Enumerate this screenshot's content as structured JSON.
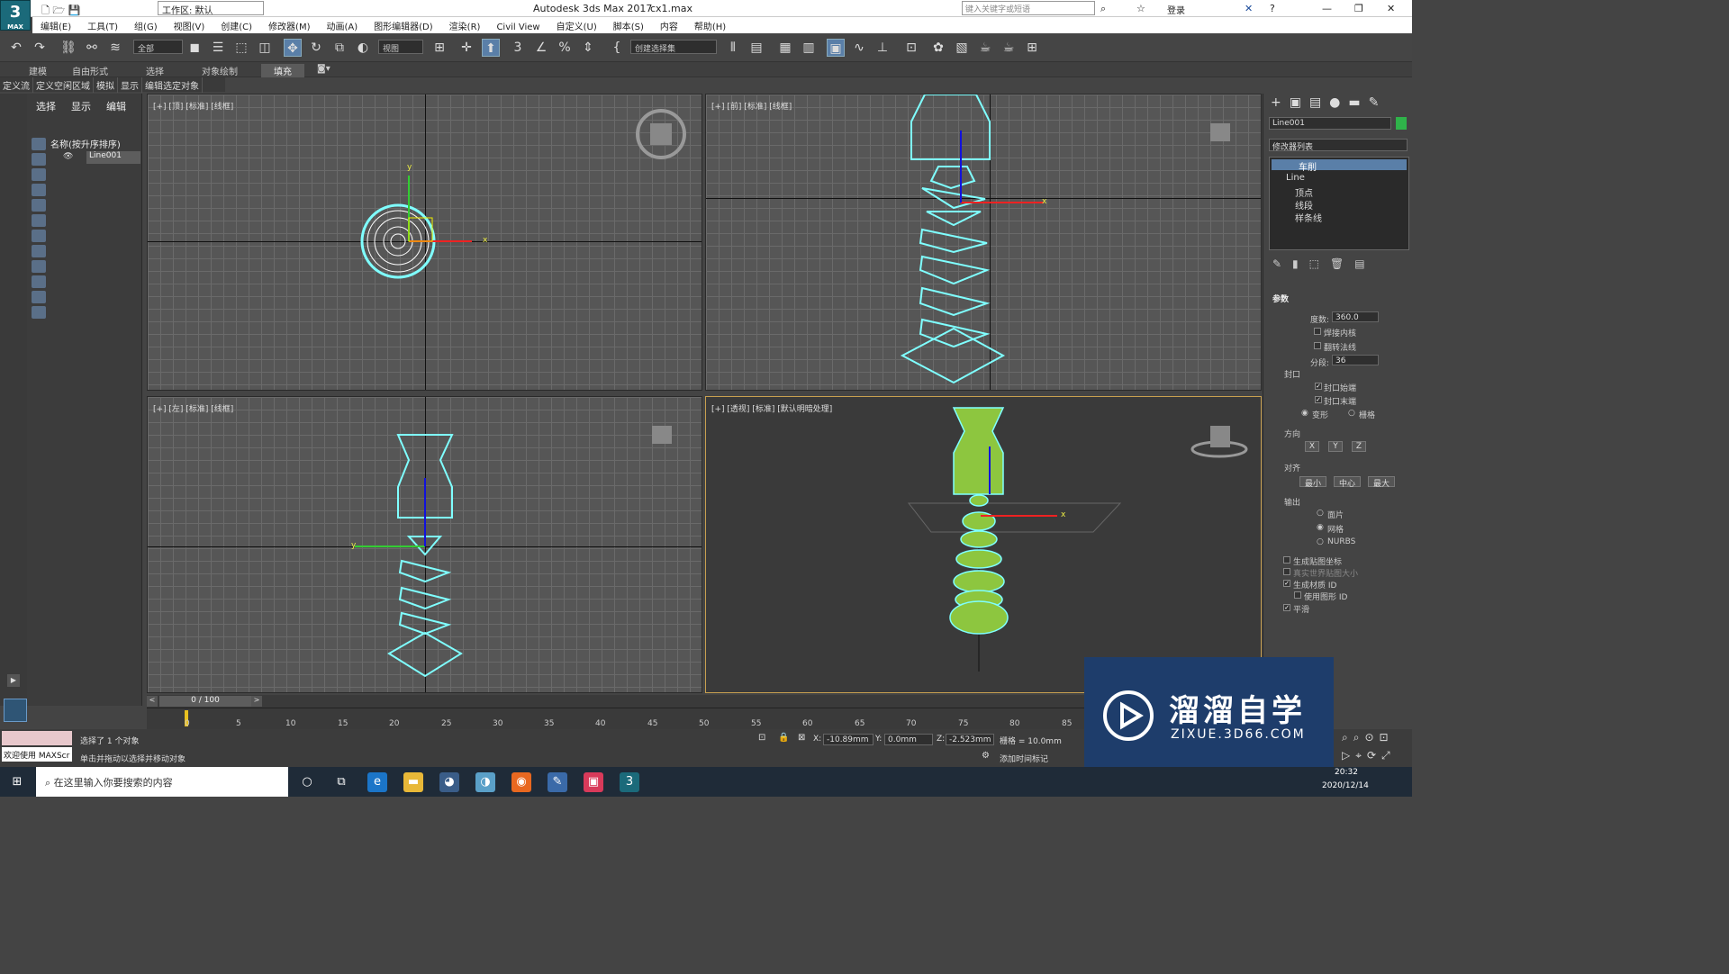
{
  "window": {
    "app_title": "Autodesk 3ds Max 2017",
    "file_name": "cx1.max",
    "workspace": "工作区: 默认",
    "search_placeholder": "键入关键字或短语",
    "login": "登录",
    "logo_text": "3",
    "logo_sub": "MAX"
  },
  "menu": [
    "编辑(E)",
    "工具(T)",
    "组(G)",
    "视图(V)",
    "创建(C)",
    "修改器(M)",
    "动画(A)",
    "图形编辑器(D)",
    "渲染(R)",
    "Civil View",
    "自定义(U)",
    "脚本(S)",
    "内容",
    "帮助(H)"
  ],
  "toolbar": {
    "filter": "全部",
    "ref_coord": "视图",
    "named_set": "创建选择集"
  },
  "ribbon": {
    "tabs": [
      "建模",
      "自由形式",
      "选择",
      "对象绘制",
      "填充"
    ],
    "active": "填充",
    "sub": [
      "定义流",
      "定义空闲区域",
      "模拟",
      "显示",
      "编辑选定对象"
    ]
  },
  "scene_explorer": {
    "tabs": [
      "选择",
      "显示",
      "编辑"
    ],
    "column": "名称(按升序排序)",
    "item": "Line001"
  },
  "viewports": [
    {
      "id": "top",
      "label": "[+] [顶] [标准] [线框]",
      "axis_x": "x",
      "axis_y": "y"
    },
    {
      "id": "front",
      "label": "[+] [前] [标准] [线框]",
      "axis_x": "x"
    },
    {
      "id": "left",
      "label": "[+] [左] [标准] [线框]",
      "axis_y": "y"
    },
    {
      "id": "persp",
      "label": "[+] [透视] [标准] [默认明暗处理]",
      "axis_x": "x"
    }
  ],
  "command_panel": {
    "object_name": "Line001",
    "modifier_list": "修改器列表",
    "stack": [
      "车削",
      "Line",
      "顶点",
      "线段",
      "样条线"
    ],
    "rollout": "参数",
    "degrees_label": "度数:",
    "degrees": "360.0",
    "weld_core": "焊接内核",
    "flip_normals": "翻转法线",
    "segments_label": "分段:",
    "segments": "36",
    "cap_group": "封口",
    "cap_start": "封口始端",
    "cap_end": "封口末端",
    "morph": "变形",
    "grid": "栅格",
    "direction_group": "方向",
    "dir_x": "X",
    "dir_y": "Y",
    "dir_z": "Z",
    "align_group": "对齐",
    "align_min": "最小",
    "align_center": "中心",
    "align_max": "最大",
    "output_group": "输出",
    "out_patch": "面片",
    "out_mesh": "网格",
    "out_nurbs": "NURBS",
    "gen_map": "生成贴图坐标",
    "real_world": "真实世界贴图大小",
    "gen_mat": "生成材质 ID",
    "use_shape": "使用图形 ID",
    "smooth": "平滑"
  },
  "timeline": {
    "frame": "0 / 100",
    "ticks": [
      "0",
      "5",
      "10",
      "15",
      "20",
      "25",
      "30",
      "35",
      "40",
      "45",
      "50",
      "55",
      "60",
      "65",
      "70",
      "75",
      "80",
      "85"
    ]
  },
  "status": {
    "selected": "选择了 1 个对象",
    "hint": "单击并拖动以选择并移动对象",
    "welcome": "欢迎使用 MAXScr",
    "x_label": "X:",
    "x": "-10.89mm",
    "y_label": "Y:",
    "y": "0.0mm",
    "z_label": "Z:",
    "z": "-2.523mm",
    "grid": "栅格 = 10.0mm",
    "add_tag": "添加时间标记"
  },
  "taskbar": {
    "search": "在这里输入你要搜索的内容",
    "time": "20:32",
    "date": "2020/12/14"
  },
  "watermark": {
    "title": "溜溜自学",
    "url": "ZIXUE.3D66.COM"
  },
  "colors": {
    "accent": "#5a7fa8",
    "object_green": "#8dc63f",
    "wire_cyan": "#7fffff"
  }
}
